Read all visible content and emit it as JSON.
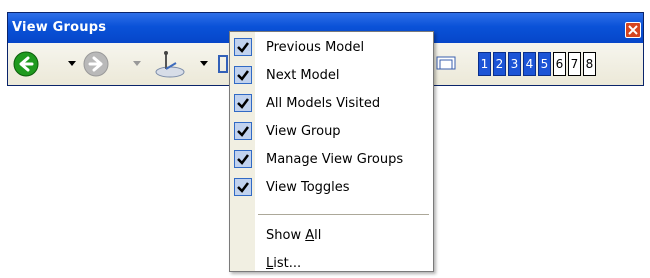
{
  "window": {
    "title": "View Groups"
  },
  "toolbar": {
    "icons": [
      "back-arrow-icon",
      "forward-arrow-icon",
      "view-group-icon",
      "view-toggle-icon"
    ],
    "view_toggles": [
      {
        "label": "1",
        "active": true
      },
      {
        "label": "2",
        "active": true
      },
      {
        "label": "3",
        "active": true
      },
      {
        "label": "4",
        "active": true
      },
      {
        "label": "5",
        "active": true
      },
      {
        "label": "6",
        "active": false
      },
      {
        "label": "7",
        "active": false
      },
      {
        "label": "8",
        "active": false
      }
    ]
  },
  "menu": {
    "items": [
      {
        "label": "Previous Model",
        "checked": true
      },
      {
        "label": "Next Model",
        "checked": true
      },
      {
        "label": "All Models Visited",
        "checked": true
      },
      {
        "label": "View Group",
        "checked": true
      },
      {
        "label": "Manage View Groups",
        "checked": true
      },
      {
        "label": "View Toggles",
        "checked": true
      }
    ],
    "show_all": {
      "pre": "Show ",
      "accel": "A",
      "post": "ll"
    },
    "list": {
      "accel": "L",
      "post": "ist..."
    }
  },
  "colors": {
    "titlebar": "#0a52d8",
    "active_toggle": "#1c54d6",
    "check_bg": "#c1d2ee"
  }
}
